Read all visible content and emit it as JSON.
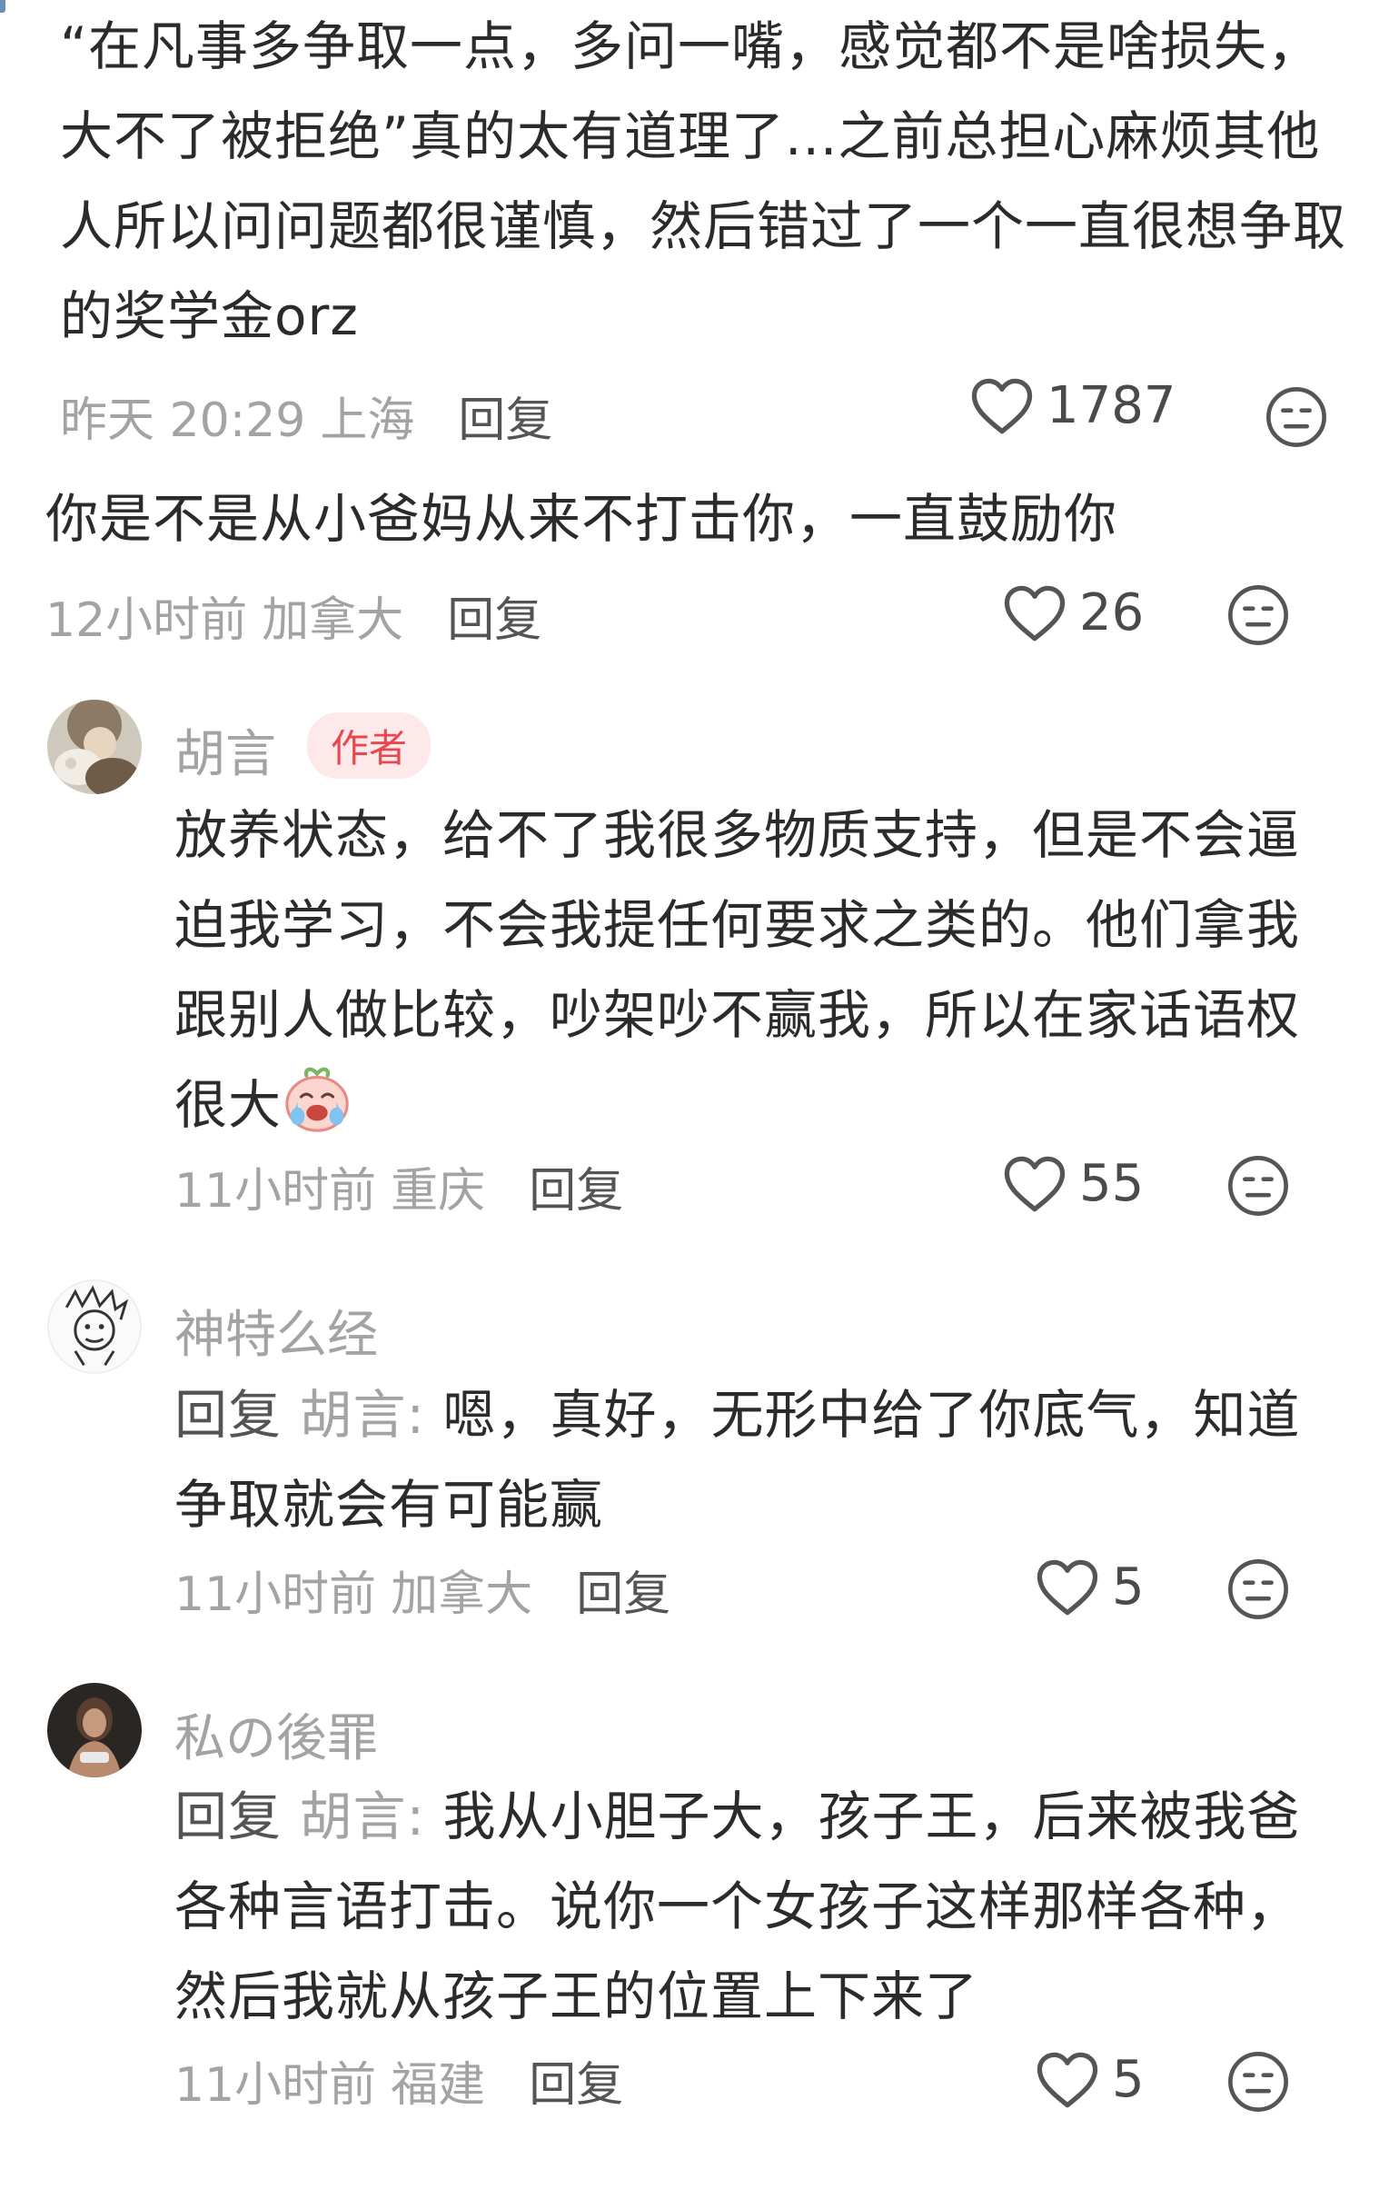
{
  "comments": [
    {
      "text": "“在凡事多争取一点，多问一嘴，感觉都不是啥损失，大不了被拒绝”真的太有道理了...之前总担心麻烦其他人所以问问题都很谨慎，然后错过了一个一直很想争取的奖学金orz",
      "time": "昨天 20:29",
      "location": "上海",
      "reply_label": "回复",
      "likes": "1787"
    },
    {
      "text": "你是不是从小爸妈从来不打击你，一直鼓励你",
      "time": "12小时前",
      "location": "加拿大",
      "reply_label": "回复",
      "likes": "26"
    },
    {
      "username": "胡言",
      "badge": "作者",
      "text": "放养状态，给不了我很多物质支持，但是不会逼迫我学习，不会我提任何要求之类的。他们拿我跟别人做比较，吵架吵不赢我，所以在家话语权很大",
      "time": "11小时前",
      "location": "重庆",
      "reply_label": "回复",
      "likes": "55"
    },
    {
      "username": "神特么经",
      "reply_prefix": "回复",
      "reply_target": "胡言:",
      "text": "嗯，真好，无形中给了你底气，知道争取就会有可能赢",
      "time": "11小时前",
      "location": "加拿大",
      "reply_label": "回复",
      "likes": "5"
    },
    {
      "username": "私の後罪",
      "reply_prefix": "回复",
      "reply_target": "胡言:",
      "text": "我从小胆子大，孩子王，后来被我爸各种言语打击。说你一个女孩子这样那样各种，然后我就从孩子王的位置上下来了",
      "time": "11小时前",
      "location": "福建",
      "reply_label": "回复",
      "likes": "5"
    }
  ],
  "icons": {
    "like": "heart-outline-icon",
    "dislike": "meh-face-icon",
    "emoji": "crying-laughing-peach-emoji"
  },
  "colors": {
    "text": "#2b2b2b",
    "meta": "#a3a3a3",
    "reply": "#545454",
    "badge_bg": "#fde8ea",
    "badge_text": "#e8474f"
  }
}
